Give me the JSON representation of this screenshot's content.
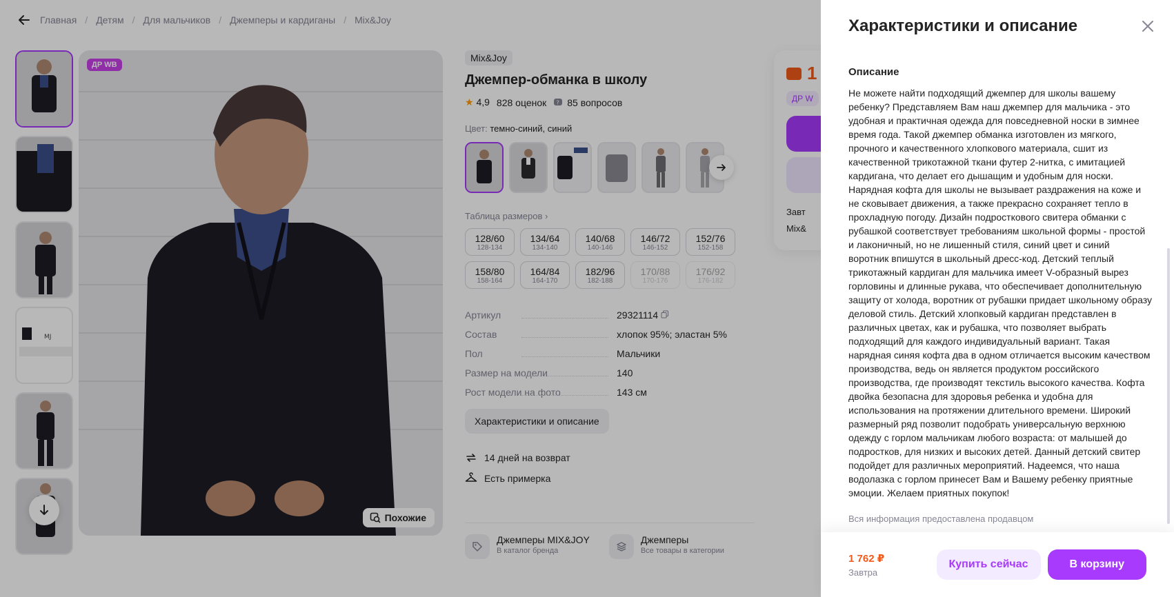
{
  "breadcrumbs": [
    "Главная",
    "Детям",
    "Для мальчиков",
    "Джемперы и кардиганы",
    "Mix&Joy"
  ],
  "gallery": {
    "badge": "ДР WB",
    "similar_label": "Похожие"
  },
  "product": {
    "brand": "Mix&Joy",
    "title": "Джемпер-обманка в школу",
    "rating": "4,9",
    "reviews": "828 оценок",
    "questions": "85 вопросов",
    "color_label": "Цвет:",
    "color_value": "темно-синий, синий",
    "size_table_label": "Таблица размеров",
    "sizes": [
      {
        "ru": "128/60",
        "alt": "128-134",
        "available": true
      },
      {
        "ru": "134/64",
        "alt": "134-140",
        "available": true
      },
      {
        "ru": "140/68",
        "alt": "140-146",
        "available": true
      },
      {
        "ru": "146/72",
        "alt": "146-152",
        "available": true
      },
      {
        "ru": "152/76",
        "alt": "152-158",
        "available": true
      },
      {
        "ru": "158/80",
        "alt": "158-164",
        "available": true
      },
      {
        "ru": "164/84",
        "alt": "164-170",
        "available": true
      },
      {
        "ru": "182/96",
        "alt": "182-188",
        "available": true
      },
      {
        "ru": "170/88",
        "alt": "170-176",
        "available": false
      },
      {
        "ru": "176/92",
        "alt": "176-182",
        "available": false
      }
    ],
    "props": [
      {
        "k": "Артикул",
        "v": "29321114"
      },
      {
        "k": "Состав",
        "v": "хлопок 95%; эластан 5%"
      },
      {
        "k": "Пол",
        "v": "Мальчики"
      },
      {
        "k": "Размер на модели",
        "v": "140"
      },
      {
        "k": "Рост модели на фото",
        "v": "143 см"
      }
    ],
    "char_button": "Характеристики и описание",
    "perk_return": "14 дней на возврат",
    "perk_fitting": "Есть примерка",
    "link_brand_title": "Джемперы MIX&JOY",
    "link_brand_sub": "В каталог бренда",
    "link_cat_title": "Джемперы",
    "link_cat_sub": "Все товары в категории"
  },
  "price_card": {
    "price_partial": "1",
    "dr_partial": "ДР W",
    "delivery_partial": "Завт",
    "seller_partial": "Mix&"
  },
  "drawer": {
    "title": "Характеристики и описание",
    "section": "Описание",
    "description": "Не можете найти подходящий джемпер для школы вашему ребенку? Представляем Вам наш джемпер для мальчика - это удобная и практичная одежда для повседневной носки в зимнее время года. Такой джемпер обманка изготовлен из мягкого, прочного и качественного хлопкового материала, сшит из качественной трикотажной ткани футер 2-нитка, с имитацией кардигана, что делает его дышащим и удобным для носки. Нарядная кофта для школы не вызывает раздражения на коже и не сковывает движения, а также прекрасно сохраняет тепло в прохладную погоду. Дизайн подросткового свитера обманки с рубашкой соответствует требованиям школьной формы - простой и лаконичный, но не лишенный стиля, синий цвет и синий воротник впишутся в школьный дресс-код. Детский теплый трикотажный кардиган для мальчика имеет V-образный вырез горловины и длинные рукава, что обеспечивает дополнительную защиту от холода, воротник от рубашки придает школьному образу деловой стиль. Детский хлопковый кардиган представлен в различных цветах, как и рубашка, что позволяет выбрать подходящий для каждого индивидуальный вариант. Такая нарядная синяя кофта два в одном отличается высоким качеством производства, ведь он является продуктом российского производства, где производят текстиль высокого качества. Кофта двойка безопасна для здоровья ребенка и удобна для использования на протяжении длительного времени. Широкий размерный ряд позволит подобрать универсальную верхнюю одежду с горлом мальчикам любого возраста: от малышей до подростков, для низких и высоких детей. Данный детский свитер подойдет для различных мероприятий. Надеемся, что наша водолазка с горлом принесет Вам и Вашему ребенку приятные эмоции. Желаем приятных покупок!",
    "seller_note": "Вся информация предоставлена продавцом",
    "price": "1 762 ₽",
    "delivery": "Завтра",
    "buy_now": "Купить сейчас",
    "add_to_cart": "В корзину"
  },
  "colors": {
    "accent": "#a73afd",
    "price": "#f05a1a"
  }
}
